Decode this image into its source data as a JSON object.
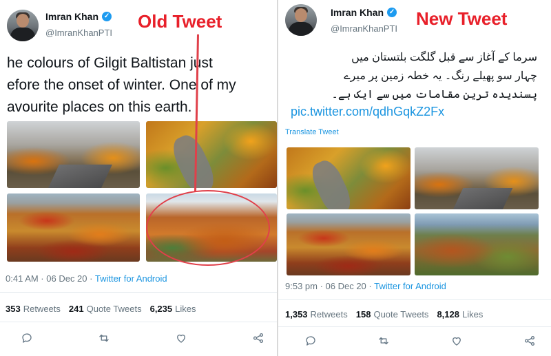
{
  "old_tweet": {
    "label": "Old Tweet",
    "author": {
      "name": "Imran Khan",
      "handle": "@ImranKhanPTI",
      "verified_mark": "✓"
    },
    "text_lines": [
      "he colours of Gilgit Baltistan just",
      "efore the onset of winter. One of my",
      "avourite places on this earth."
    ],
    "images": [
      "ph-mountain",
      "ph-road",
      "ph-village",
      "ph-hills"
    ],
    "timestamp": "0:41 AM · 06 Dec 20 · ",
    "source": "Twitter for Android",
    "stats": {
      "retweets_count": "353",
      "retweets_label": "Retweets",
      "quotes_count": "241",
      "quotes_label": "Quote Tweets",
      "likes_count": "6,235",
      "likes_label": "Likes"
    },
    "actions": [
      "reply-icon",
      "retweet-icon",
      "like-icon",
      "share-icon"
    ]
  },
  "new_tweet": {
    "label": "New Tweet",
    "author": {
      "name": "Imran Khan",
      "handle": "@ImranKhanPTI",
      "verified_mark": "✓"
    },
    "text_lines": [
      "سرما کے آغاز سے قبل گلگت بلتستان میں",
      "چہار سو پھیلے رنگ۔ یہ خطہ زمین پر میرے",
      "پسندیدہ ترین مقامات میں سے ایک ہے۔"
    ],
    "link": "pic.twitter.com/qdhGqkZ2Fx",
    "translate": "Translate Tweet",
    "images": [
      "ph-road",
      "ph-mountain",
      "ph-village",
      "ph-valley"
    ],
    "timestamp": "9:53 pm · 06 Dec 20 · ",
    "source": "Twitter for Android",
    "stats": {
      "retweets_count": "1,353",
      "retweets_label": "Retweets",
      "quotes_count": "158",
      "quotes_label": "Quote Tweets",
      "likes_count": "8,128",
      "likes_label": "Likes"
    },
    "actions": [
      "reply-icon",
      "retweet-icon",
      "like-icon",
      "share-icon"
    ]
  },
  "colors": {
    "label_red": "#e8202a",
    "link_blue": "#1b95e0",
    "verified_blue": "#1d9bf0"
  }
}
